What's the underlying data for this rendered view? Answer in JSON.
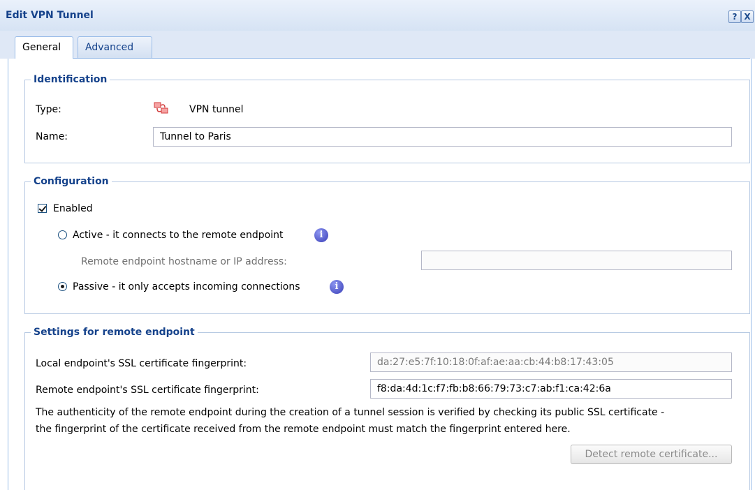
{
  "window": {
    "title": "Edit VPN Tunnel",
    "help_label": "?",
    "close_label": "X"
  },
  "tabs": [
    {
      "label": "General",
      "active": true
    },
    {
      "label": "Advanced",
      "active": false
    }
  ],
  "identification": {
    "legend": "Identification",
    "type_label": "Type:",
    "type_icon": "vpn-tunnel-icon",
    "type_value": "VPN tunnel",
    "name_label": "Name:",
    "name_value": "Tunnel to Paris"
  },
  "configuration": {
    "legend": "Configuration",
    "enabled_label": "Enabled",
    "enabled_checked": true,
    "active_label": "Active - it connects to the remote endpoint",
    "active_selected": false,
    "remote_host_label": "Remote endpoint hostname or IP address:",
    "remote_host_value": "",
    "passive_label": "Passive - it only accepts incoming connections",
    "passive_selected": true,
    "info_glyph": "i"
  },
  "remote_settings": {
    "legend": "Settings for remote endpoint",
    "local_fp_label": "Local endpoint's SSL certificate fingerprint:",
    "local_fp_value": "da:27:e5:7f:10:18:0f:af:ae:aa:cb:44:b8:17:43:05",
    "remote_fp_label": "Remote endpoint's SSL certificate fingerprint:",
    "remote_fp_value": "f8:da:4d:1c:f7:fb:b8:66:79:73:c7:ab:f1:ca:42:6a",
    "description_line1": "The authenticity of the remote endpoint during the creation of a tunnel session is verified by checking its public SSL certificate -",
    "description_line2": "the fingerprint of the certificate received from the remote endpoint must match the fingerprint entered here.",
    "detect_button_label": "Detect remote certificate..."
  },
  "colors": {
    "title_text": "#15428b",
    "border_blue": "#99bbe8",
    "info_blue": "#3a3fb8"
  }
}
